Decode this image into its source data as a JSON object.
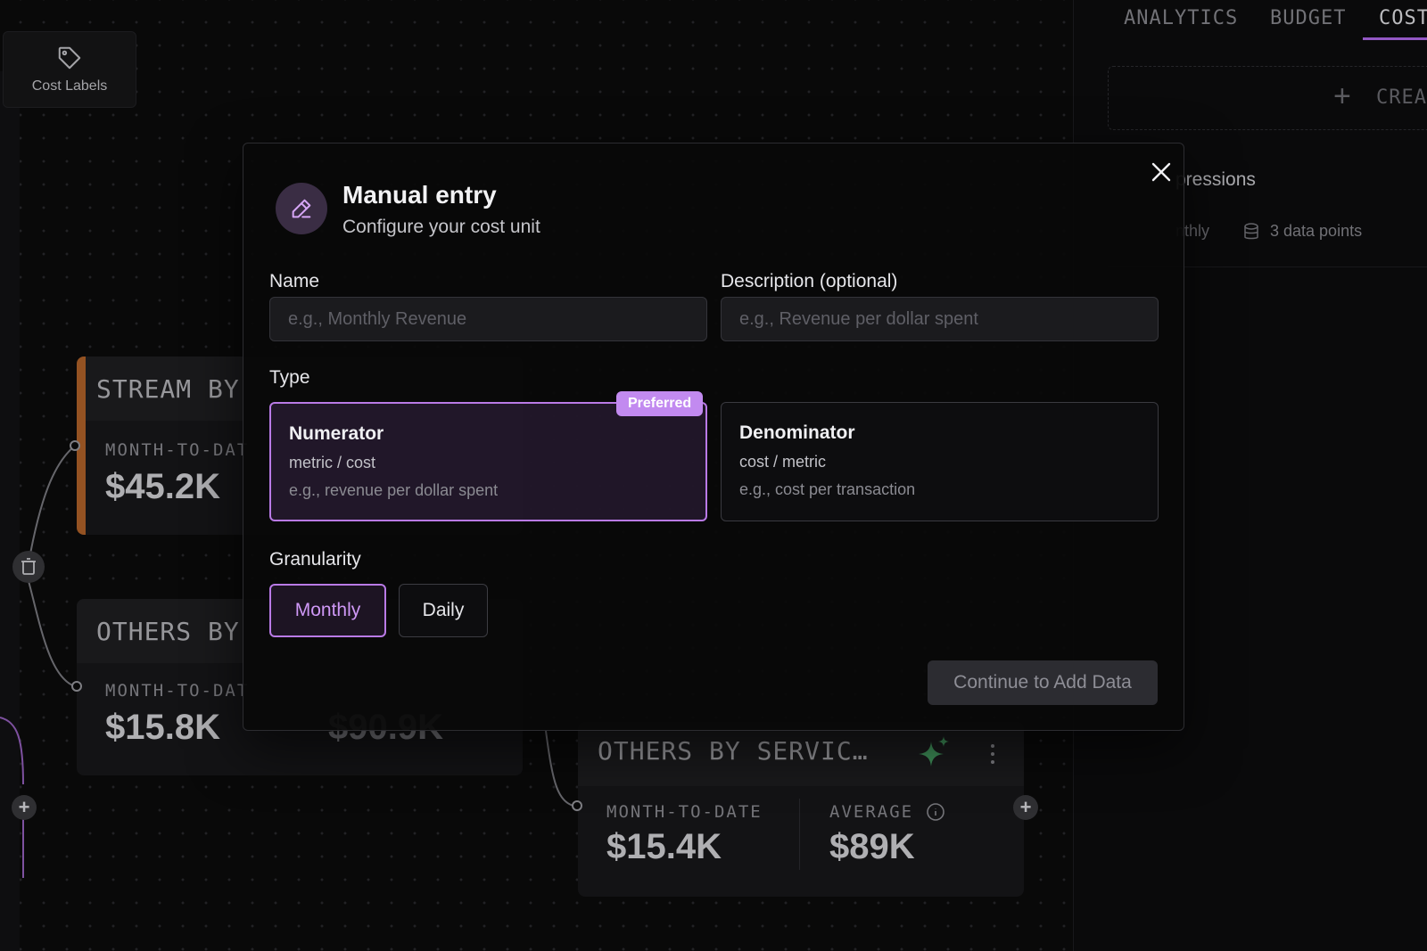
{
  "sidebar": {
    "cost_labels": "Cost Labels"
  },
  "cards": {
    "stream": {
      "title": "STREAM BY",
      "mtd_label": "MONTH-TO-DAT",
      "mtd_value": "$45.2K"
    },
    "others_left": {
      "title": "OTHERS BY",
      "mtd_label": "MONTH-TO-DAT",
      "mtd_value": "$15.8K",
      "avg_value": "$90.9K"
    },
    "others_service": {
      "title": "OTHERS BY SERVIC…",
      "mtd_label": "MONTH-TO-DATE",
      "mtd_value": "$15.4K",
      "avg_label": "AVERAGE",
      "avg_value": "$89K"
    }
  },
  "right_panel": {
    "tabs": [
      "ANALYTICS",
      "BUDGET",
      "COST"
    ],
    "create_label": "CREAT",
    "metric_name": "pressions",
    "metric_granularity": "nthly",
    "metric_points": "3 data points"
  },
  "modal": {
    "title": "Manual entry",
    "subtitle": "Configure your cost unit",
    "name_label": "Name",
    "name_placeholder": "e.g., Monthly Revenue",
    "name_value": "",
    "desc_label": "Description (optional)",
    "desc_placeholder": "e.g., Revenue per dollar spent",
    "desc_value": "",
    "type_label": "Type",
    "preferred_badge": "Preferred",
    "types": [
      {
        "title": "Numerator",
        "formula": "metric / cost",
        "example": "e.g., revenue per dollar spent",
        "selected": true
      },
      {
        "title": "Denominator",
        "formula": "cost / metric",
        "example": "e.g., cost per transaction",
        "selected": false
      }
    ],
    "granularity_label": "Granularity",
    "granularity": [
      {
        "label": "Monthly",
        "selected": true
      },
      {
        "label": "Daily",
        "selected": false
      }
    ],
    "continue_label": "Continue to Add Data"
  },
  "colors": {
    "accent_purple": "#b97ae6",
    "badge_purple": "#c28af0",
    "stream_accent": "#b5652a",
    "sparkle_green": "#4cae6c"
  }
}
